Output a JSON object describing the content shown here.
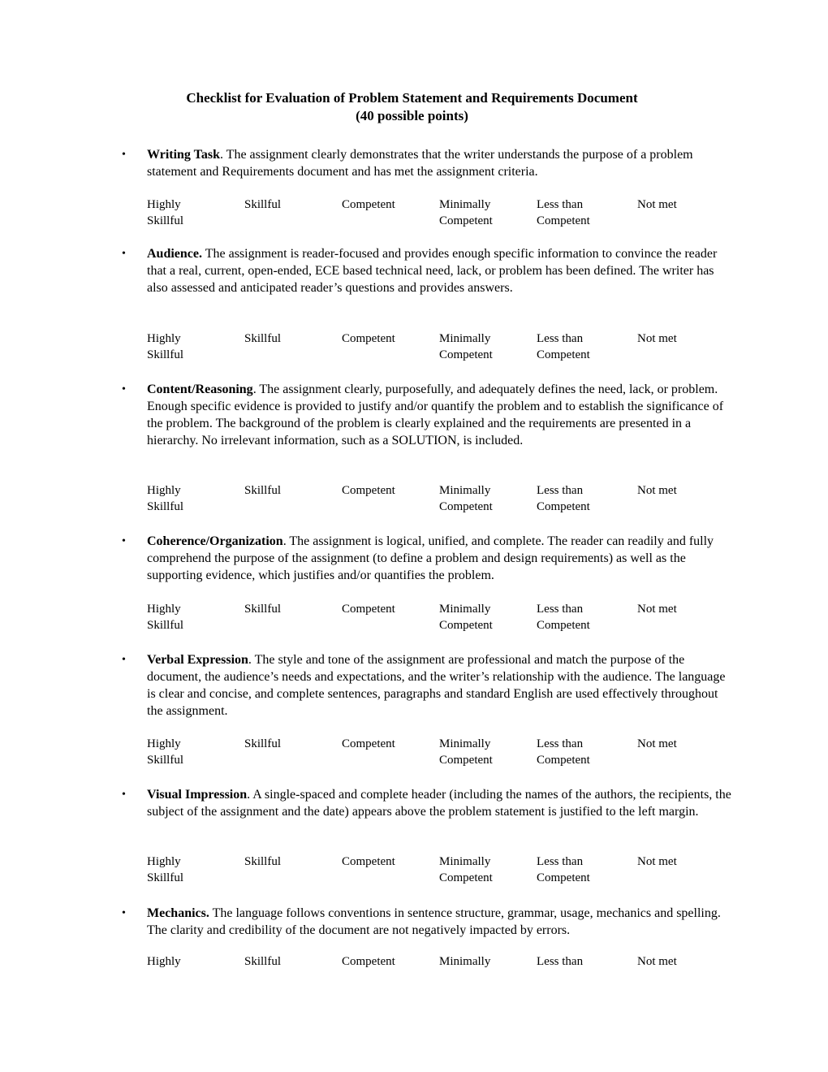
{
  "title": {
    "line1": "Checklist for Evaluation of Problem Statement and Requirements Document",
    "line2": "(40 possible points)"
  },
  "rating_scale": [
    {
      "line1": "Highly",
      "line2": "Skillful"
    },
    {
      "line1": "Skillful",
      "line2": ""
    },
    {
      "line1": "Competent",
      "line2": ""
    },
    {
      "line1": "Minimally",
      "line2": "Competent"
    },
    {
      "line1": "Less than",
      "line2": "Competent"
    },
    {
      "line1": "Not met",
      "line2": ""
    }
  ],
  "criteria": [
    {
      "heading": "Writing Task",
      "heading_suffix": ".",
      "text": "  The assignment clearly demonstrates that the writer understands the purpose of a problem statement and Requirements document and has met the assignment criteria."
    },
    {
      "heading": "Audience.",
      "heading_suffix": "",
      "text": "  The assignment is reader-focused and provides enough specific information to convince the reader that a real, current, open-ended, ECE based technical need, lack, or problem has been defined.  The writer has also assessed and anticipated reader’s questions and provides answers."
    },
    {
      "heading": "Content/Reasoning",
      "heading_suffix": ".",
      "text": "  The assignment clearly, purposefully, and adequately defines the need, lack, or problem.  Enough specific evidence is provided to justify and/or quantify the problem and to establish the significance of the problem. The background of the problem is clearly explained and the requirements are presented in a hierarchy. No irrelevant information, such as a SOLUTION, is included."
    },
    {
      "heading": "Coherence/Organization",
      "heading_suffix": ".",
      "text": "  The assignment is logical, unified, and complete.  The reader can readily and fully comprehend the purpose of the assignment (to define a problem and design requirements) as well as the supporting evidence, which justifies and/or quantifies the problem."
    },
    {
      "heading": "Verbal Expression",
      "heading_suffix": ".",
      "text": "  The style and tone of the assignment are professional and match the purpose of the document, the audience’s needs and expectations, and the writer’s relationship with the audience.  The language is clear and concise, and complete sentences, paragraphs and standard English are used effectively throughout the assignment."
    },
    {
      "heading": "Visual Impression",
      "heading_suffix": ".",
      "text": "  A single-spaced and complete header (including the names of the authors, the recipients, the subject of the assignment and the date) appears above the problem statement is justified to the left margin."
    },
    {
      "heading": "Mechanics.",
      "heading_suffix": "",
      "text": "  The language follows conventions in sentence structure, grammar, usage, mechanics and spelling.  The clarity and credibility of the document are not negatively impacted by errors."
    }
  ],
  "bullet_glyph": "•"
}
